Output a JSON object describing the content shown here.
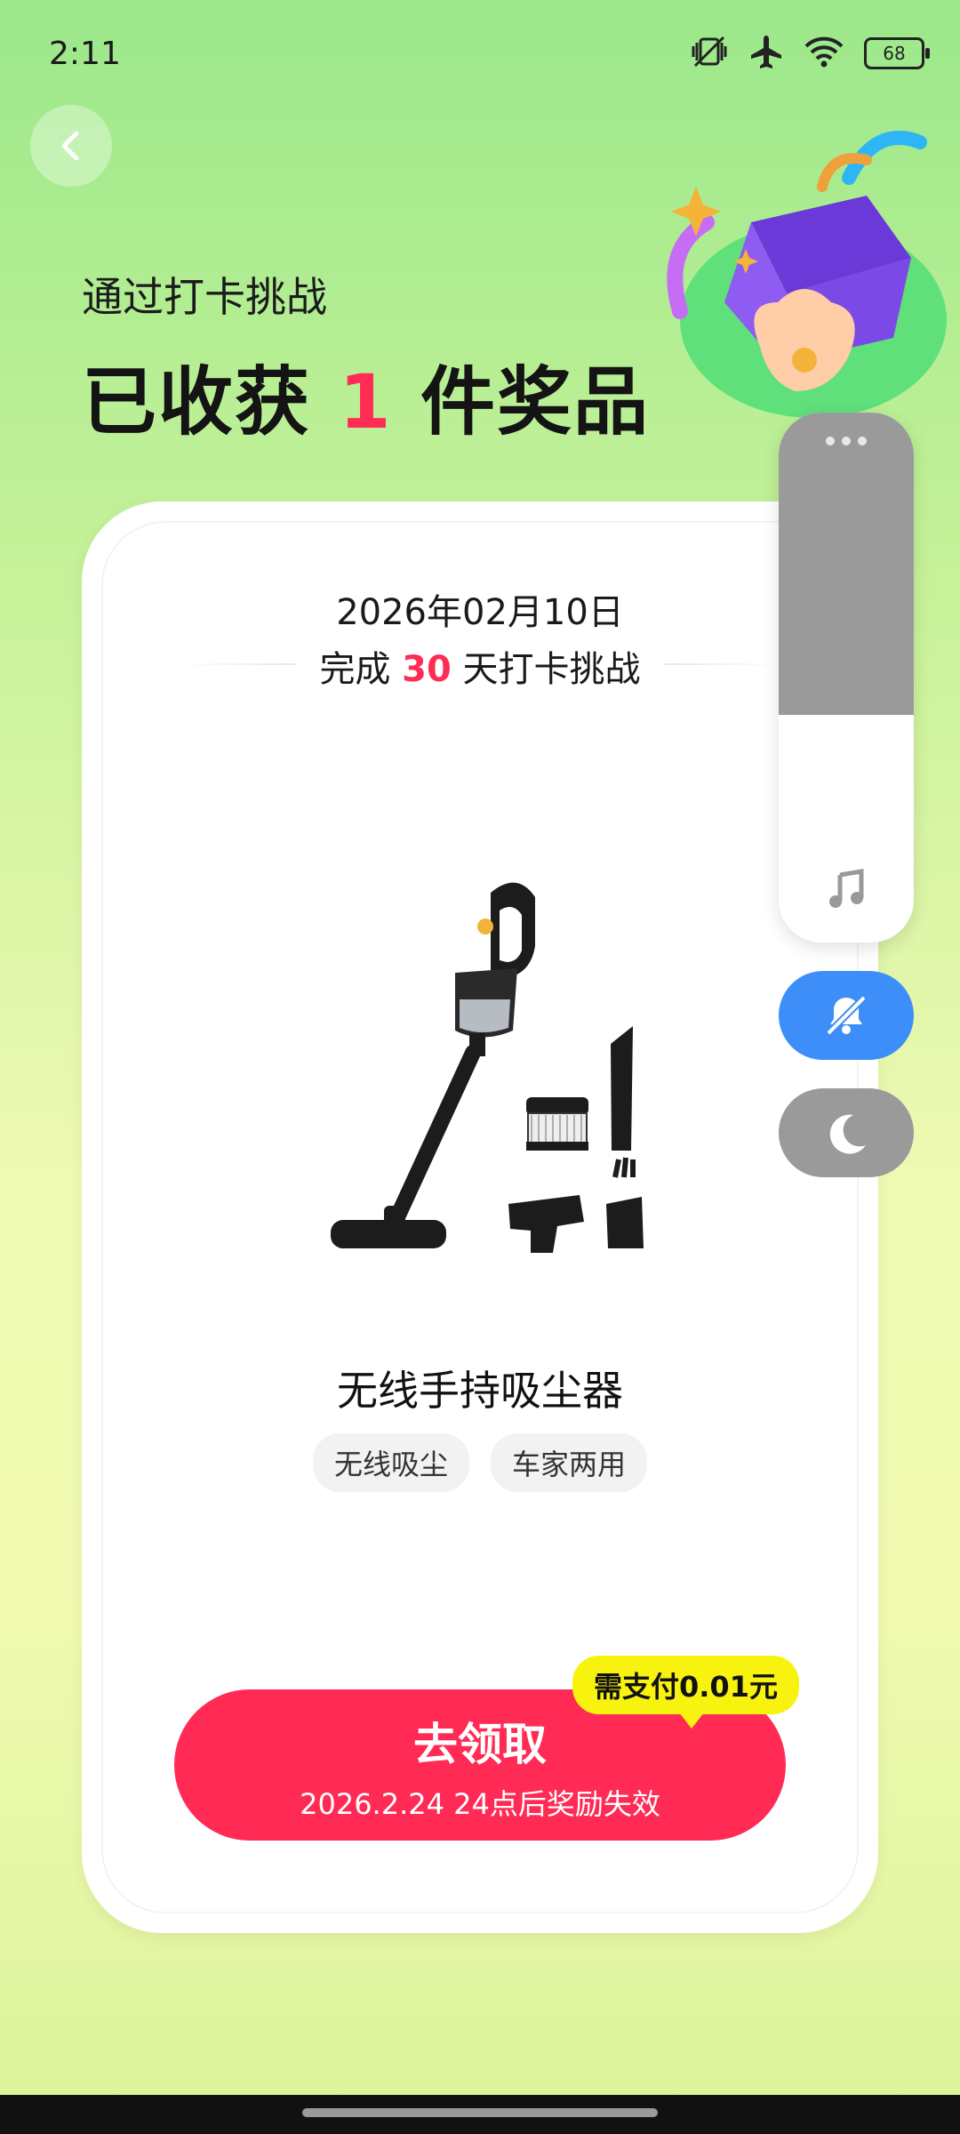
{
  "status_bar": {
    "time": "2:11",
    "battery": "68"
  },
  "header": {
    "subtitle": "通过打卡挑战",
    "title_prefix": "已收获",
    "title_count": "1",
    "title_suffix": "件奖品"
  },
  "card": {
    "date": "2026年02月10日",
    "challenge_prefix": "完成",
    "challenge_days": "30",
    "challenge_suffix": "天打卡挑战",
    "product_name": "无线手持吸尘器",
    "tags": [
      "无线吸尘",
      "车家两用"
    ]
  },
  "claim": {
    "label": "去领取",
    "expiry": "2026.2.24 24点后奖励失效",
    "pay_note": "需支付0.01元"
  },
  "volume_panel": {
    "level": 0.57
  },
  "colors": {
    "accent": "#ff2b55",
    "highlight": "#f7f20e",
    "mute_blue": "#3d8ef8"
  }
}
